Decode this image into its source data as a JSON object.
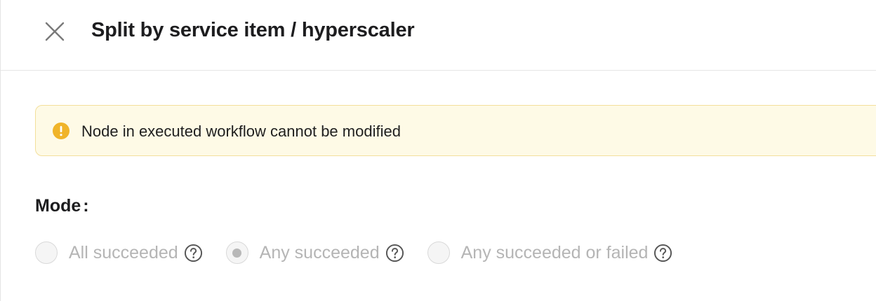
{
  "header": {
    "title": "Split by service item / hyperscaler",
    "close_icon": "close-icon"
  },
  "banner": {
    "message": "Node in executed workflow cannot be modified",
    "icon": "warning-icon",
    "icon_color": "#f0b429",
    "background": "#fefae6",
    "border_color": "#f3df9b"
  },
  "mode": {
    "label": "Mode",
    "separator": ":",
    "options": [
      {
        "label": "All succeeded",
        "selected": false,
        "disabled": true,
        "help_icon": "help-icon"
      },
      {
        "label": "Any succeeded",
        "selected": true,
        "disabled": true,
        "help_icon": "help-icon"
      },
      {
        "label": "Any succeeded or failed",
        "selected": false,
        "disabled": true,
        "help_icon": "help-icon"
      }
    ]
  }
}
